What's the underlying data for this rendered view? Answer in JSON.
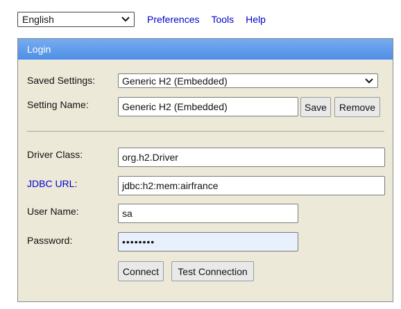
{
  "topbar": {
    "language": "English",
    "links": [
      "Preferences",
      "Tools",
      "Help"
    ]
  },
  "login": {
    "header": "Login",
    "saved_settings_label": "Saved Settings:",
    "saved_settings_value": "Generic H2 (Embedded)",
    "setting_name_label": "Setting Name:",
    "setting_name_value": "Generic H2 (Embedded)",
    "save_label": "Save",
    "remove_label": "Remove",
    "driver_class_label": "Driver Class:",
    "driver_class_value": "org.h2.Driver",
    "jdbc_url_label": "JDBC URL",
    "jdbc_url_colon": ":",
    "jdbc_url_value": "jdbc:h2:mem:airfrance",
    "user_name_label": "User Name:",
    "user_name_value": "sa",
    "password_label": "Password:",
    "password_value": "••••••••",
    "connect_label": "Connect",
    "test_connection_label": "Test Connection"
  },
  "colors": {
    "header_gradient_top": "#78acf0",
    "header_gradient_bottom": "#4d8fe6",
    "panel_bg": "#ece9d8",
    "link": "#0000cc",
    "password_bg": "#e8f0fe"
  }
}
